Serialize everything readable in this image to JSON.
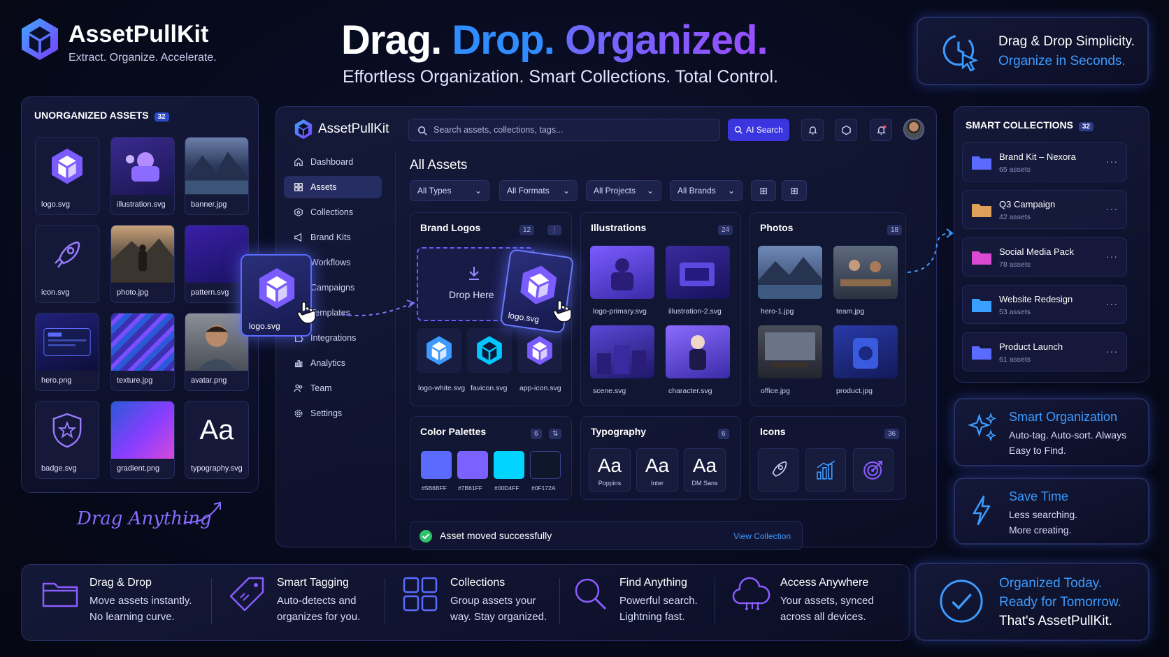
{
  "brand": {
    "name": "AssetPullKit",
    "tagline": "Extract. Organize. Accelerate."
  },
  "hero": {
    "headline_w1": "Drag.",
    "headline_w2": "Drop.",
    "headline_w3": "Organized.",
    "subheadline": "Effortless Organization. Smart Collections. Total Control."
  },
  "top_right_card": {
    "line1": "Drag & Drop Simplicity.",
    "line2": "Organize in Seconds."
  },
  "unorganized": {
    "title": "UNORGANIZED ASSETS",
    "count": "32",
    "items": [
      {
        "label": "logo.svg"
      },
      {
        "label": "illustration.svg"
      },
      {
        "label": "banner.jpg"
      },
      {
        "label": "icon.svg"
      },
      {
        "label": "photo.jpg"
      },
      {
        "label": "pattern.svg"
      },
      {
        "label": "hero.png"
      },
      {
        "label": "texture.jpg"
      },
      {
        "label": "avatar.png"
      },
      {
        "label": "badge.svg"
      },
      {
        "label": "gradient.png"
      },
      {
        "label": "typography.svg"
      }
    ],
    "typography_glyph": "Aa",
    "drag_note": "Drag Anything"
  },
  "dragged": {
    "left_label": "logo.svg",
    "right_label": "logo.svg"
  },
  "app": {
    "brand": "AssetPullKit",
    "search_placeholder": "Search assets, collections, tags...",
    "ai_search": "AI Search",
    "sidebar": [
      {
        "label": "Dashboard",
        "icon": "home-icon"
      },
      {
        "label": "Assets",
        "icon": "layers-icon"
      },
      {
        "label": "Collections",
        "icon": "stack-icon"
      },
      {
        "label": "Brand Kits",
        "icon": "megaphone-icon"
      },
      {
        "label": "Workflows",
        "icon": "workflow-icon"
      },
      {
        "label": "Campaigns",
        "icon": "campaign-icon"
      },
      {
        "label": "Templates",
        "icon": "template-icon"
      },
      {
        "label": "Integrations",
        "icon": "puzzle-icon"
      },
      {
        "label": "Analytics",
        "icon": "chart-icon"
      },
      {
        "label": "Team",
        "icon": "team-icon"
      },
      {
        "label": "Settings",
        "icon": "gear-icon"
      }
    ],
    "page_title": "All Assets",
    "filters": [
      "All Types",
      "All Formats",
      "All Projects",
      "All Brands"
    ],
    "brand_logos": {
      "title": "Brand Logos",
      "count": "12",
      "drop_here": "Drop Here",
      "items": [
        "logo-white.svg",
        "favicon.svg",
        "app-icon.svg"
      ]
    },
    "illustrations": {
      "title": "Illustrations",
      "count": "24",
      "items": [
        "logo-primary.svg",
        "illustration-2.svg",
        "scene.svg",
        "character.svg"
      ]
    },
    "photos": {
      "title": "Photos",
      "count": "18",
      "items": [
        "hero-1.jpg",
        "team.jpg",
        "office.jpg",
        "product.jpg"
      ]
    },
    "palettes": {
      "title": "Color Palettes",
      "count": "6",
      "swatches": [
        {
          "hex": "#5B6BFF",
          "label": "#5B6BFF"
        },
        {
          "hex": "#7B61FF",
          "label": "#7B61FF"
        },
        {
          "hex": "#00D4FF",
          "label": "#00D4FF"
        },
        {
          "hex": "#0F172A",
          "label": "#0F172A"
        }
      ]
    },
    "typography": {
      "title": "Typography",
      "count": "6",
      "items": [
        {
          "glyph": "Aa",
          "font": "Poppins"
        },
        {
          "glyph": "Aa",
          "font": "Inter"
        },
        {
          "glyph": "Aa",
          "font": "DM Sans"
        }
      ]
    },
    "icons": {
      "title": "Icons",
      "count": "36"
    },
    "toast": {
      "message": "Asset moved successfully",
      "action": "View Collection"
    }
  },
  "smart_collections": {
    "title": "SMART COLLECTIONS",
    "count": "32",
    "items": [
      {
        "name": "Brand Kit – Nexora",
        "meta": "65 assets",
        "color": "#5b6bff"
      },
      {
        "name": "Q3 Campaign",
        "meta": "42 assets",
        "color": "#e0a05a"
      },
      {
        "name": "Social Media Pack",
        "meta": "78 assets",
        "color": "#d94ad1"
      },
      {
        "name": "Website Redesign",
        "meta": "53 assets",
        "color": "#3aa0ff"
      },
      {
        "name": "Product Launch",
        "meta": "61 assets",
        "color": "#5b6bff"
      }
    ]
  },
  "right_cards": [
    {
      "title": "Smart Organization",
      "desc1": "Auto-tag. Auto-sort. Always",
      "desc2": "Easy to Find."
    },
    {
      "title": "Save Time",
      "desc1": "Less searching.",
      "desc2": "More creating."
    }
  ],
  "bottom_features": [
    {
      "title": "Drag & Drop",
      "d1": "Move assets instantly.",
      "d2": "No learning curve."
    },
    {
      "title": "Smart Tagging",
      "d1": "Auto-detects and",
      "d2": "organizes for you."
    },
    {
      "title": "Collections",
      "d1": "Group assets your",
      "d2": "way. Stay organized."
    },
    {
      "title": "Find Anything",
      "d1": "Powerful search.",
      "d2": "Lightning fast."
    },
    {
      "title": "Access Anywhere",
      "d1": "Your assets, synced",
      "d2": "across all devices."
    }
  ],
  "bottom_right": {
    "l1": "Organized Today.",
    "l2": "Ready for Tomorrow.",
    "l3": "That's AssetPullKit."
  }
}
